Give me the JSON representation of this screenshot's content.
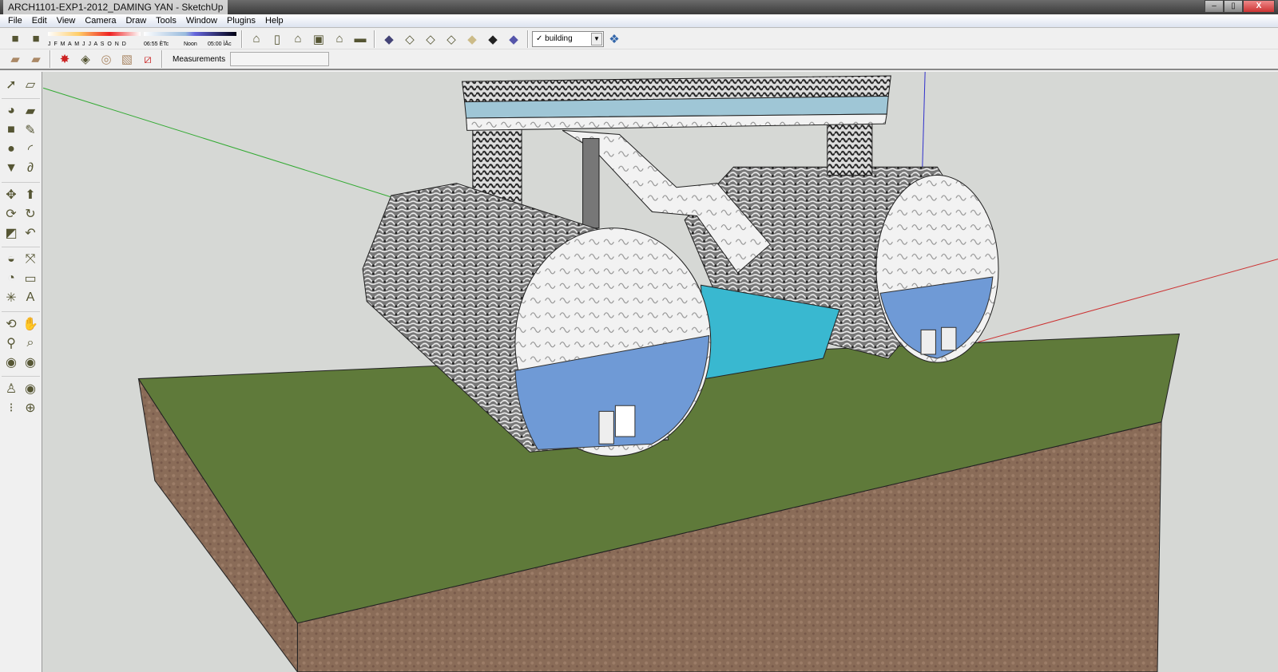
{
  "window": {
    "title": "ARCH1101-EXP1-2012_DAMING YAN - SketchUp",
    "minimize": "–",
    "restore": "▯",
    "close": "X"
  },
  "menu": [
    "File",
    "Edit",
    "View",
    "Camera",
    "Draw",
    "Tools",
    "Window",
    "Plugins",
    "Help"
  ],
  "shadow": {
    "months": "J F M A M J J A S O N D",
    "time_start": "06:55 ÈTc",
    "time_mid": "Noon",
    "time_end": "05:00 ÌÅc"
  },
  "layer": {
    "checked": "✓",
    "name": "building"
  },
  "measurements": {
    "label": "Measurements",
    "value": ""
  },
  "toolbar_icons": [
    "component-info-icon",
    "component-icon",
    "iso-view-icon",
    "front-view-icon",
    "right-view-icon",
    "top-view-icon",
    "back-view-icon",
    "left-view-icon",
    "xray-icon",
    "wireframe-icon",
    "hidden-line-icon",
    "hidden-line2-icon",
    "shaded-icon",
    "shaded-textures-icon",
    "monochrome-icon",
    "layer-manager-icon"
  ],
  "left_tools": [
    [
      "select-icon",
      "make-component-icon"
    ],
    [
      "paint-bucket-icon",
      "eraser-icon"
    ],
    [
      "rectangle-icon",
      "pencil-icon"
    ],
    [
      "circle-icon",
      "arc-icon"
    ],
    [
      "polygon-icon",
      "freehand-icon"
    ],
    [
      "move-icon",
      "push-pull-icon"
    ],
    [
      "rotate-icon",
      "follow-me-icon"
    ],
    [
      "scale-icon",
      "offset-icon"
    ],
    [
      "tape-measure-icon",
      "dimension-icon"
    ],
    [
      "protractor-icon",
      "text-icon"
    ],
    [
      "axes-icon",
      "3d-text-icon"
    ],
    [
      "orbit-icon",
      "pan-icon"
    ],
    [
      "zoom-icon",
      "zoom-window-icon"
    ],
    [
      "previous-view-icon",
      "next-view-icon"
    ],
    [
      "position-camera-icon",
      "look-around-icon"
    ],
    [
      "walk-icon",
      "section-plane-icon"
    ]
  ],
  "colors": {
    "ground": "#5f7a3a",
    "soil": "#8a6a55",
    "sky": "#d6d8d5",
    "water": "#6fa0d8",
    "pool": "#39b8d0"
  }
}
